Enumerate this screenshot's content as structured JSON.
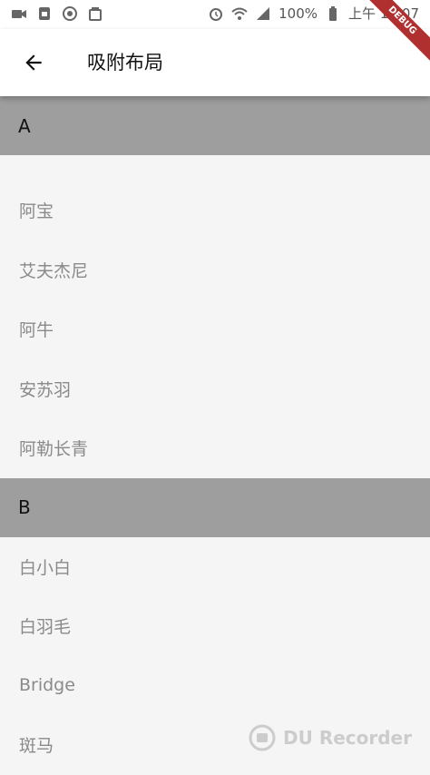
{
  "status": {
    "battery_text": "100%",
    "time": "上午 11:07"
  },
  "appbar": {
    "title": "吸附布局"
  },
  "debug_label": "DEBUG",
  "sections": [
    {
      "header": "A",
      "items": [
        "阿宝",
        "艾夫杰尼",
        "阿牛",
        "安苏羽",
        "阿勒长青"
      ]
    },
    {
      "header": "B",
      "items": [
        "白小白",
        "白羽毛",
        "Bridge",
        "斑马"
      ]
    }
  ],
  "watermark": {
    "text": "DU Recorder"
  },
  "colors": {
    "section_bg": "#9e9e9e",
    "item_text": "#8a8a8a",
    "page_bg": "#f5f5f5"
  }
}
